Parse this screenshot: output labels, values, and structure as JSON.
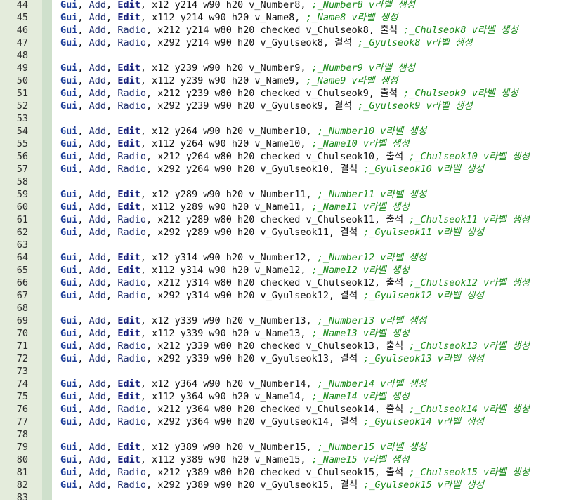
{
  "editor": {
    "language": "AutoHotkey",
    "colors": {
      "keyword": "#1f3f99",
      "comment": "#1b8a1b",
      "gutter": "#e4ecdc",
      "text": "#111111"
    },
    "lines": [
      {
        "n": "44",
        "kw": "Gui",
        "cmd": "Add",
        "ctrl": "Edit",
        "args": ", x12 y214 w90 h20 v_Number8, ",
        "comment": ";_Number8 v라벨 생성"
      },
      {
        "n": "45",
        "kw": "Gui",
        "cmd": "Add",
        "ctrl": "Edit",
        "args": ", x112 y214 w90 h20 v_Name8, ",
        "comment": ";_Name8 v라벨 생성"
      },
      {
        "n": "46",
        "kw": "Gui",
        "cmd": "Add",
        "ctrl": "Radio",
        "args": ", x212 y214 w80 h20 checked v_Chulseok8, 출석 ",
        "comment": ";_Chulseok8 v라벨 생성"
      },
      {
        "n": "47",
        "kw": "Gui",
        "cmd": "Add",
        "ctrl": "Radio",
        "args": ", x292 y214 w90 h20 v_Gyulseok8, 결석 ",
        "comment": ";_Gyulseok8 v라벨 생성"
      },
      {
        "n": "48",
        "kw": "",
        "cmd": "",
        "ctrl": "",
        "args": "",
        "comment": ""
      },
      {
        "n": "49",
        "kw": "Gui",
        "cmd": "Add",
        "ctrl": "Edit",
        "args": ", x12 y239 w90 h20 v_Number9, ",
        "comment": ";_Number9 v라벨 생성"
      },
      {
        "n": "50",
        "kw": "Gui",
        "cmd": "Add",
        "ctrl": "Edit",
        "args": ", x112 y239 w90 h20 v_Name9, ",
        "comment": ";_Name9 v라벨 생성"
      },
      {
        "n": "51",
        "kw": "Gui",
        "cmd": "Add",
        "ctrl": "Radio",
        "args": ", x212 y239 w80 h20 checked v_Chulseok9, 출석 ",
        "comment": ";_Chulseok9 v라벨 생성"
      },
      {
        "n": "52",
        "kw": "Gui",
        "cmd": "Add",
        "ctrl": "Radio",
        "args": ", x292 y239 w90 h20 v_Gyulseok9, 결석 ",
        "comment": ";_Gyulseok9 v라벨 생성"
      },
      {
        "n": "53",
        "kw": "",
        "cmd": "",
        "ctrl": "",
        "args": "",
        "comment": ""
      },
      {
        "n": "54",
        "kw": "Gui",
        "cmd": "Add",
        "ctrl": "Edit",
        "args": ", x12 y264 w90 h20 v_Number10, ",
        "comment": ";_Number10 v라벨 생성"
      },
      {
        "n": "55",
        "kw": "Gui",
        "cmd": "Add",
        "ctrl": "Edit",
        "args": ", x112 y264 w90 h20 v_Name10, ",
        "comment": ";_Name10 v라벨 생성"
      },
      {
        "n": "56",
        "kw": "Gui",
        "cmd": "Add",
        "ctrl": "Radio",
        "args": ", x212 y264 w80 h20 checked v_Chulseok10, 출석 ",
        "comment": ";_Chulseok10 v라벨 생성"
      },
      {
        "n": "57",
        "kw": "Gui",
        "cmd": "Add",
        "ctrl": "Radio",
        "args": ", x292 y264 w90 h20 v_Gyulseok10, 결석 ",
        "comment": ";_Gyulseok10 v라벨 생성"
      },
      {
        "n": "58",
        "kw": "",
        "cmd": "",
        "ctrl": "",
        "args": "",
        "comment": ""
      },
      {
        "n": "59",
        "kw": "Gui",
        "cmd": "Add",
        "ctrl": "Edit",
        "args": ", x12 y289 w90 h20 v_Number11, ",
        "comment": ";_Number11 v라벨 생성"
      },
      {
        "n": "60",
        "kw": "Gui",
        "cmd": "Add",
        "ctrl": "Edit",
        "args": ", x112 y289 w90 h20 v_Name11, ",
        "comment": ";_Name11 v라벨 생성"
      },
      {
        "n": "61",
        "kw": "Gui",
        "cmd": "Add",
        "ctrl": "Radio",
        "args": ", x212 y289 w80 h20 checked v_Chulseok11, 출석 ",
        "comment": ";_Chulseok11 v라벨 생성"
      },
      {
        "n": "62",
        "kw": "Gui",
        "cmd": "Add",
        "ctrl": "Radio",
        "args": ", x292 y289 w90 h20 v_Gyulseok11, 결석 ",
        "comment": ";_Gyulseok11 v라벨 생성"
      },
      {
        "n": "63",
        "kw": "",
        "cmd": "",
        "ctrl": "",
        "args": "",
        "comment": ""
      },
      {
        "n": "64",
        "kw": "Gui",
        "cmd": "Add",
        "ctrl": "Edit",
        "args": ", x12 y314 w90 h20 v_Number12, ",
        "comment": ";_Number12 v라벨 생성"
      },
      {
        "n": "65",
        "kw": "Gui",
        "cmd": "Add",
        "ctrl": "Edit",
        "args": ", x112 y314 w90 h20 v_Name12, ",
        "comment": ";_Name12 v라벨 생성"
      },
      {
        "n": "66",
        "kw": "Gui",
        "cmd": "Add",
        "ctrl": "Radio",
        "args": ", x212 y314 w80 h20 checked v_Chulseok12, 출석 ",
        "comment": ";_Chulseok12 v라벨 생성"
      },
      {
        "n": "67",
        "kw": "Gui",
        "cmd": "Add",
        "ctrl": "Radio",
        "args": ", x292 y314 w90 h20 v_Gyulseok12, 결석 ",
        "comment": ";_Gyulseok12 v라벨 생성"
      },
      {
        "n": "68",
        "kw": "",
        "cmd": "",
        "ctrl": "",
        "args": "",
        "comment": ""
      },
      {
        "n": "69",
        "kw": "Gui",
        "cmd": "Add",
        "ctrl": "Edit",
        "args": ", x12 y339 w90 h20 v_Number13, ",
        "comment": ";_Number13 v라벨 생성"
      },
      {
        "n": "70",
        "kw": "Gui",
        "cmd": "Add",
        "ctrl": "Edit",
        "args": ", x112 y339 w90 h20 v_Name13, ",
        "comment": ";_Name13 v라벨 생성"
      },
      {
        "n": "71",
        "kw": "Gui",
        "cmd": "Add",
        "ctrl": "Radio",
        "args": ", x212 y339 w80 h20 checked v_Chulseok13, 출석 ",
        "comment": ";_Chulseok13 v라벨 생성"
      },
      {
        "n": "72",
        "kw": "Gui",
        "cmd": "Add",
        "ctrl": "Radio",
        "args": ", x292 y339 w90 h20 v_Gyulseok13, 결석 ",
        "comment": ";_Gyulseok13 v라벨 생성"
      },
      {
        "n": "73",
        "kw": "",
        "cmd": "",
        "ctrl": "",
        "args": "",
        "comment": ""
      },
      {
        "n": "74",
        "kw": "Gui",
        "cmd": "Add",
        "ctrl": "Edit",
        "args": ", x12 y364 w90 h20 v_Number14, ",
        "comment": ";_Number14 v라벨 생성"
      },
      {
        "n": "75",
        "kw": "Gui",
        "cmd": "Add",
        "ctrl": "Edit",
        "args": ", x112 y364 w90 h20 v_Name14, ",
        "comment": ";_Name14 v라벨 생성"
      },
      {
        "n": "76",
        "kw": "Gui",
        "cmd": "Add",
        "ctrl": "Radio",
        "args": ", x212 y364 w80 h20 checked v_Chulseok14, 출석 ",
        "comment": ";_Chulseok14 v라벨 생성"
      },
      {
        "n": "77",
        "kw": "Gui",
        "cmd": "Add",
        "ctrl": "Radio",
        "args": ", x292 y364 w90 h20 v_Gyulseok14, 결석 ",
        "comment": ";_Gyulseok14 v라벨 생성"
      },
      {
        "n": "78",
        "kw": "",
        "cmd": "",
        "ctrl": "",
        "args": "",
        "comment": ""
      },
      {
        "n": "79",
        "kw": "Gui",
        "cmd": "Add",
        "ctrl": "Edit",
        "args": ", x12 y389 w90 h20 v_Number15, ",
        "comment": ";_Number15 v라벨 생성"
      },
      {
        "n": "80",
        "kw": "Gui",
        "cmd": "Add",
        "ctrl": "Edit",
        "args": ", x112 y389 w90 h20 v_Name15, ",
        "comment": ";_Name15 v라벨 생성"
      },
      {
        "n": "81",
        "kw": "Gui",
        "cmd": "Add",
        "ctrl": "Radio",
        "args": ", x212 y389 w80 h20 checked v_Chulseok15, 출석 ",
        "comment": ";_Chulseok15 v라벨 생성"
      },
      {
        "n": "82",
        "kw": "Gui",
        "cmd": "Add",
        "ctrl": "Radio",
        "args": ", x292 y389 w90 h20 v_Gyulseok15, 결석 ",
        "comment": ";_Gyulseok15 v라벨 생성"
      },
      {
        "n": "83",
        "kw": "",
        "cmd": "",
        "ctrl": "",
        "args": "",
        "comment": ""
      }
    ]
  }
}
